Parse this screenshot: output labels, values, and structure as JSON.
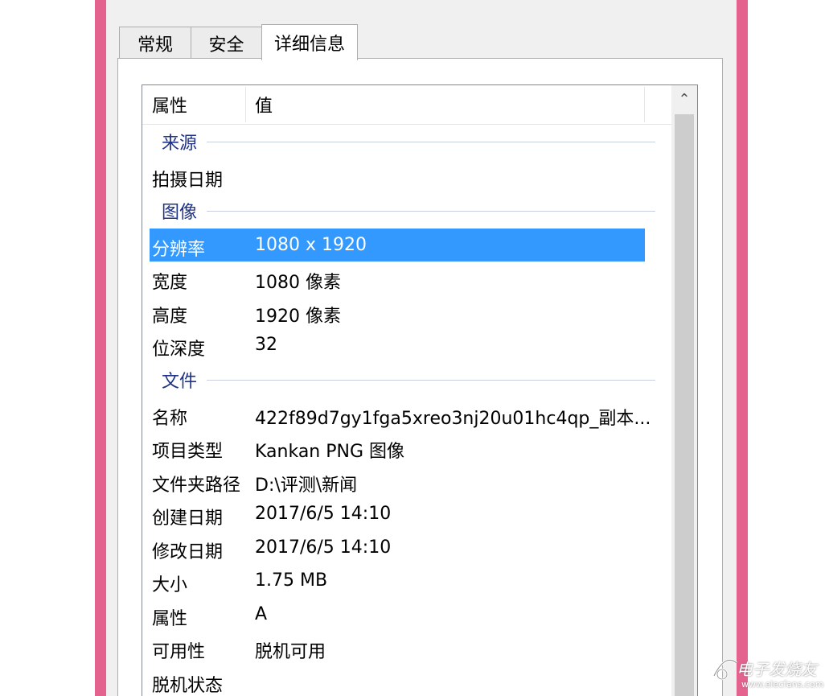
{
  "colors": {
    "window_frame": "#e4628e",
    "selection": "#3399ff",
    "group_text": "#1e3287"
  },
  "tabs": [
    {
      "label": "常规",
      "active": false
    },
    {
      "label": "安全",
      "active": false
    },
    {
      "label": "详细信息",
      "active": true
    }
  ],
  "list": {
    "headers": {
      "property": "属性",
      "value": "值"
    },
    "groups": [
      {
        "label": "来源",
        "rows": [
          {
            "name": "拍摄日期",
            "value": ""
          }
        ]
      },
      {
        "label": "图像",
        "rows": [
          {
            "name": "分辨率",
            "value": "1080 x 1920",
            "selected": true
          },
          {
            "name": "宽度",
            "value": "1080 像素"
          },
          {
            "name": "高度",
            "value": "1920 像素"
          },
          {
            "name": "位深度",
            "value": "32"
          }
        ]
      },
      {
        "label": "文件",
        "rows": [
          {
            "name": "名称",
            "value": "422f89d7gy1fga5xreo3nj20u01hc4qp_副本..."
          },
          {
            "name": "项目类型",
            "value": "Kankan PNG 图像"
          },
          {
            "name": "文件夹路径",
            "value": "D:\\评测\\新闻"
          },
          {
            "name": "创建日期",
            "value": "2017/6/5 14:10"
          },
          {
            "name": "修改日期",
            "value": "2017/6/5 14:10"
          },
          {
            "name": "大小",
            "value": "1.75 MB"
          },
          {
            "name": "属性",
            "value": "A"
          },
          {
            "name": "可用性",
            "value": "脱机可用"
          },
          {
            "name": "脱机状态",
            "value": ""
          }
        ]
      }
    ]
  },
  "scrollbar": {
    "up_icon": "chevron-up-icon",
    "glyph": "⌃"
  },
  "watermark": {
    "title": "电子发烧友",
    "url": "www.elecfans.com"
  }
}
